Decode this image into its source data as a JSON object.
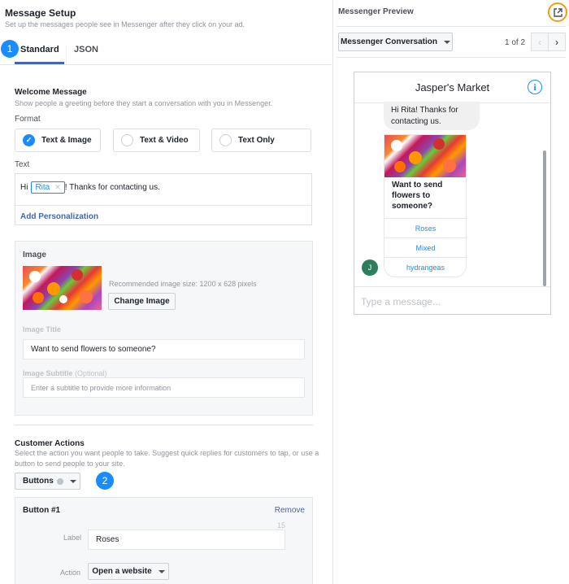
{
  "setup": {
    "title": "Message Setup",
    "subtitle": "Set up the messages people see in Messenger after they click on your ad.",
    "step1": "1",
    "step2": "2",
    "tabs": [
      {
        "label": "Standard",
        "active": true
      },
      {
        "label": "JSON",
        "active": false
      }
    ]
  },
  "welcome": {
    "title": "Welcome Message",
    "subtitle": "Show people a greeting before they start a conversation with you in Messenger.",
    "format_label": "Format",
    "formats": [
      {
        "label": "Text & Image",
        "selected": true
      },
      {
        "label": "Text & Video",
        "selected": false
      },
      {
        "label": "Text Only",
        "selected": false
      }
    ],
    "text_label": "Text",
    "text_prefix": "Hi",
    "text_chip": "Rita",
    "text_suffix": "! Thanks for contacting us.",
    "add_personalization": "Add Personalization"
  },
  "image": {
    "label": "Image",
    "recommended": "Recommended image size: 1200 x 628 pixels",
    "change_button": "Change Image",
    "title_label": "Image Title",
    "title_value": "Want to send flowers to someone?",
    "subtitle_label": "Image Subtitle",
    "subtitle_optional": "(Optional)",
    "subtitle_placeholder": "Enter a subtitle to provide more information"
  },
  "actions": {
    "title": "Customer Actions",
    "subtitle": "Select the action you want people to take. Suggest quick replies for customers to tap, or use a button to send people to your site.",
    "type_dropdown": "Buttons",
    "button1": {
      "title": "Button #1",
      "remove": "Remove",
      "char_count": "15",
      "label_label": "Label",
      "label_value": "Roses",
      "action_label": "Action",
      "action_value": "Open a website"
    }
  },
  "preview": {
    "title": "Messenger Preview",
    "view_dropdown": "Messenger Conversation",
    "pager": "1 of 2",
    "phone": {
      "page_name": "Jasper's Market",
      "greeting": "Hi Rita! Thanks for contacting us.",
      "card_title": "Want to send flowers to someone?",
      "buttons": [
        "Roses",
        "Mixed",
        "hydrangeas"
      ],
      "input_placeholder": "Type a message...",
      "avatar_initial": "J"
    }
  },
  "colors": {
    "accent": "#1a8cff",
    "link": "#4267b2",
    "highlight": "#f39c12"
  }
}
